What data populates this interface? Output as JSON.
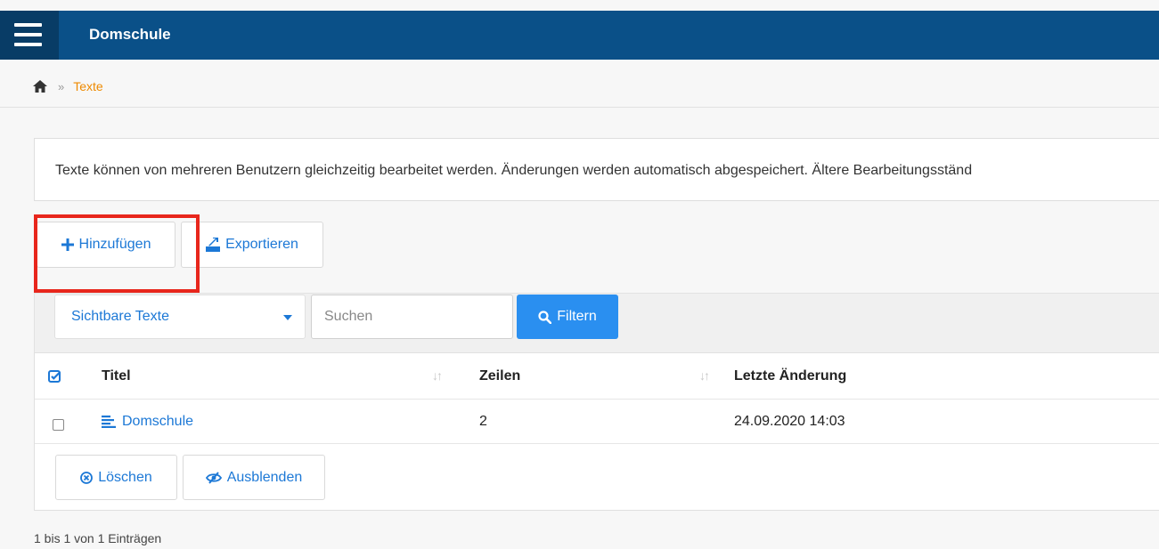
{
  "header": {
    "title": "Domschule",
    "background": "#0a5088"
  },
  "breadcrumb": {
    "separator": "»",
    "current": "Texte"
  },
  "info": {
    "text": "Texte können von mehreren Benutzern gleichzeitig bearbeitet werden. Änderungen werden automatisch abgespeichert. Ältere Bearbeitungsständ"
  },
  "toolbar": {
    "add_label": "Hinzufügen",
    "export_label": "Exportieren"
  },
  "filter": {
    "select_value": "Sichtbare Texte",
    "search_placeholder": "Suchen",
    "filter_label": "Filtern"
  },
  "table": {
    "headers": {
      "title": "Titel",
      "rows": "Zeilen",
      "modified": "Letzte Änderung"
    },
    "rows": [
      {
        "title": "Domschule",
        "lines": "2",
        "modified": "24.09.2020 14:03"
      }
    ]
  },
  "actions": {
    "delete_label": "Löschen",
    "hide_label": "Ausblenden"
  },
  "footer": {
    "entries": "1 bis 1 von 1 Einträgen"
  },
  "colors": {
    "accent": "#1c78d6",
    "primary_button": "#2a8ff0",
    "breadcrumb_current": "#ee8a00",
    "highlight": "#e8261c"
  }
}
